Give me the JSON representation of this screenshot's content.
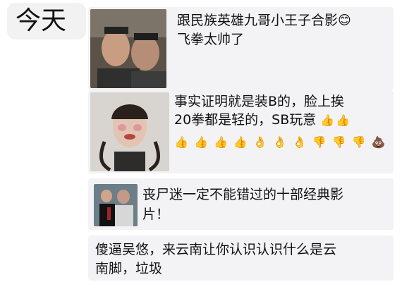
{
  "day_label": "今天",
  "posts": [
    {
      "line1": "跟民族英雄九哥小王子合影",
      "line2": "飞拳太帅了",
      "emoji": "😊"
    },
    {
      "line1": "事实证明就是装B的，脸上挨",
      "line2": "20拳都是轻的，SB玩意",
      "inline_emojis": [
        "👍",
        "👍"
      ],
      "emoji_row": [
        "👍",
        "👍",
        "👍",
        "👍",
        "👌",
        "👌",
        "👌",
        "👎",
        "👎",
        "👎",
        "💩"
      ]
    },
    {
      "line1": "丧尸迷一定不能错过的十部经典影",
      "line2": "片！"
    },
    {
      "line1": "傻逼吴悠，来云南让你认识认识什么是云",
      "line2": "南脚，垃圾"
    }
  ]
}
